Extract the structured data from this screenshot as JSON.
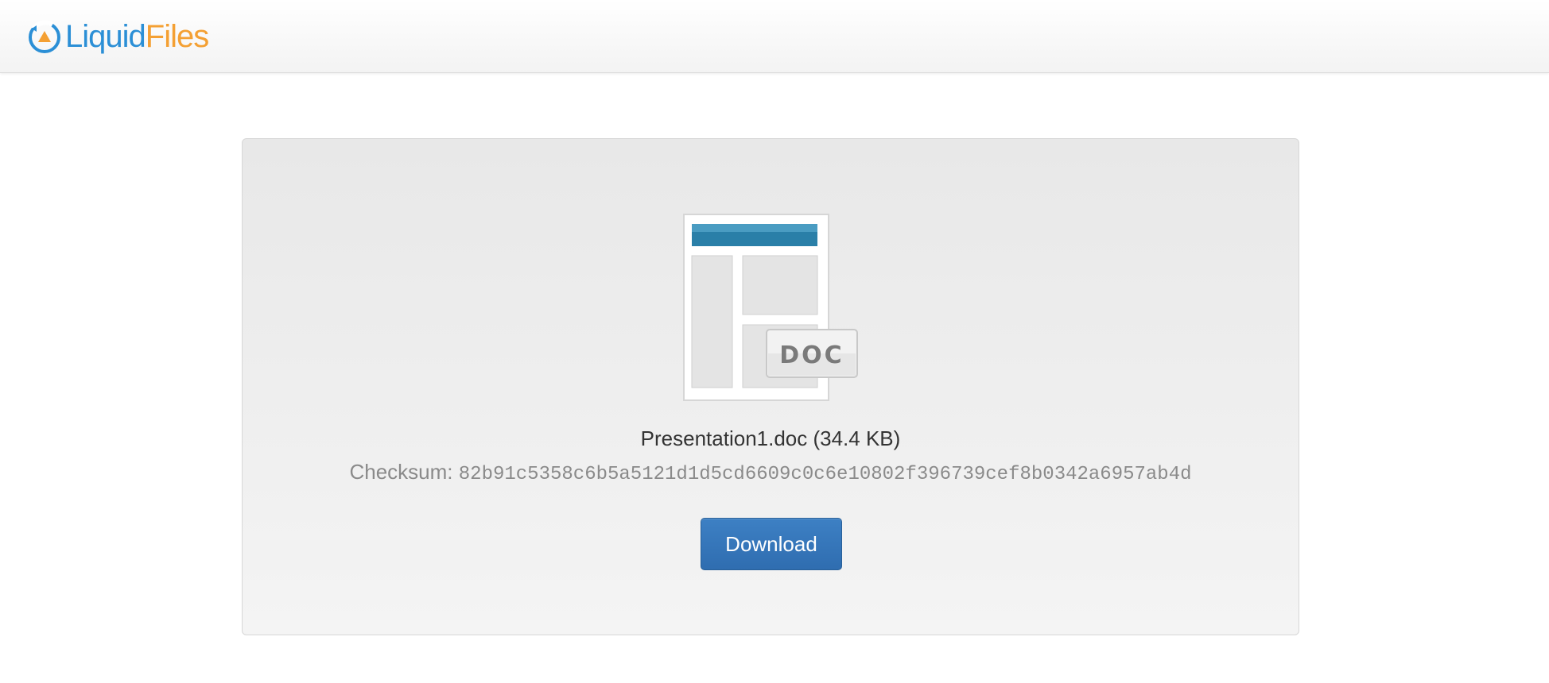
{
  "header": {
    "logo": {
      "word1": "Liquid",
      "word2": "Files",
      "color1": "#2b8fd6",
      "color2": "#f4a033"
    }
  },
  "file": {
    "name_size": "Presentation1.doc (34.4 KB)",
    "type_badge": "DOC",
    "checksum_label": "Checksum:",
    "checksum_value": "82b91c5358c6b5a5121d1d5cd6609c0c6e10802f396739cef8b0342a6957ab4d",
    "icon": "doc-file-icon"
  },
  "actions": {
    "download_label": "Download",
    "accent": "#337ab7"
  }
}
